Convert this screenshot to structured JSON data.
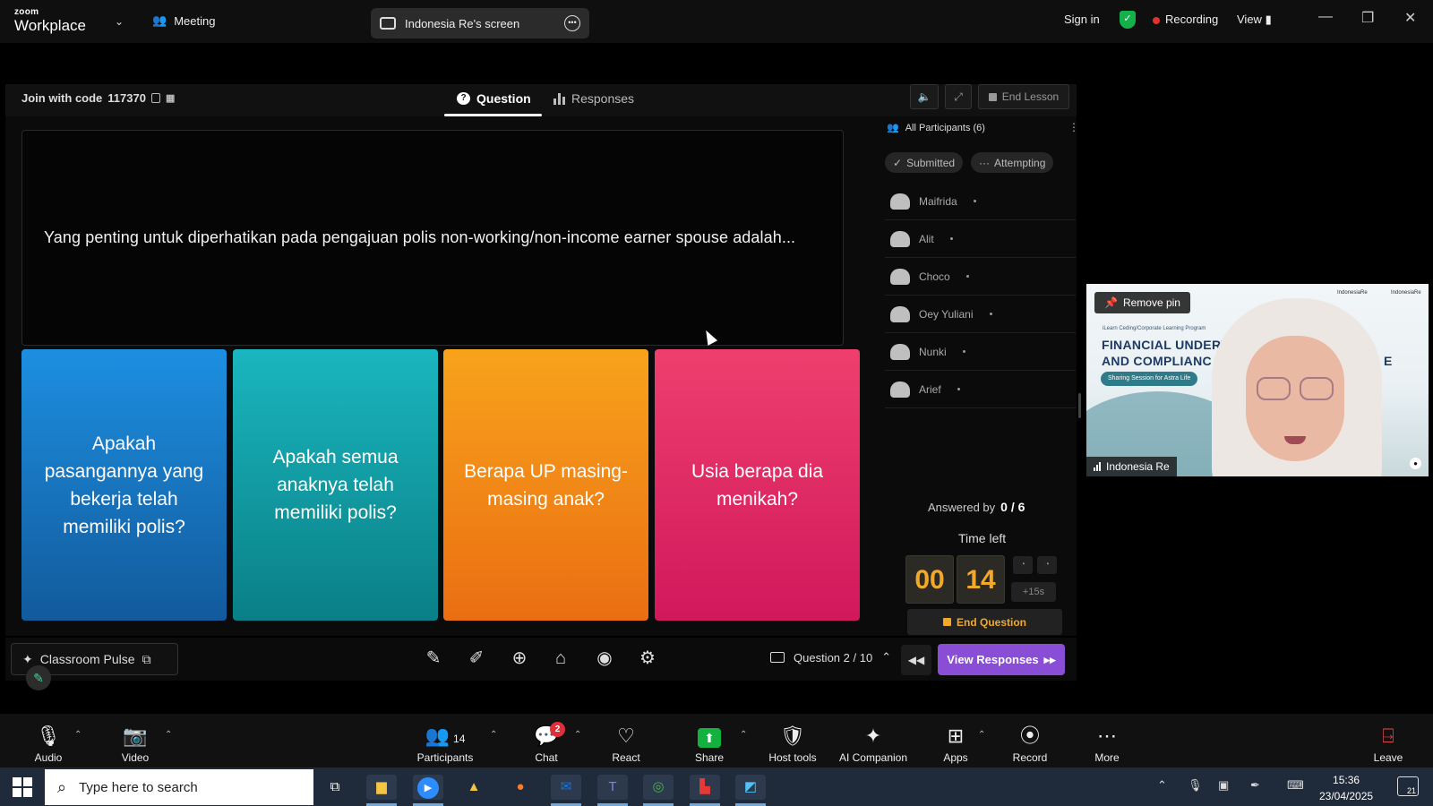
{
  "topbar": {
    "logo_small": "zoom",
    "logo_large": "Workplace",
    "meeting_label": "Meeting",
    "screen_share_label": "Indonesia Re's screen",
    "sign_in": "Sign in",
    "recording": "Recording",
    "view": "View"
  },
  "lesson": {
    "join_label": "Join with code",
    "join_code": "117370",
    "tabs": [
      "Question",
      "Responses"
    ],
    "end_lesson": "End Lesson",
    "question": "Yang penting untuk diperhatikan pada pengajuan polis non-working/non-income earner spouse adalah...",
    "answers": [
      {
        "text": "Apakah pasangannya yang bekerja telah memiliki polis?",
        "color": "#1d8fe0"
      },
      {
        "text": "Apakah semua anaknya telah memiliki polis?",
        "color": "#1ab6bf"
      },
      {
        "text": "Berapa UP masing-masing anak?",
        "color": "#f8a31c"
      },
      {
        "text": "Usia berapa dia menikah?",
        "color": "#ee3f6e"
      }
    ]
  },
  "participants": {
    "header": "All Participants (6)",
    "filters": [
      "Submitted",
      "Attempting"
    ],
    "list": [
      "Maifrida",
      "Alit",
      "Choco",
      "Oey Yuliani",
      "Nunki",
      "Arief"
    ],
    "answered_label": "Answered by",
    "answered_value": "0 / 6"
  },
  "timer": {
    "label": "Time left",
    "minutes": "00",
    "seconds": "14",
    "add_time": "+15s",
    "end_question": "End Question",
    "accent": "#f2a92a"
  },
  "lesson_toolbar": {
    "classroom_pulse": "Classroom Pulse",
    "question_nav": "Question 2 / 10",
    "view_responses": "View Responses",
    "accent": "#8a4dd6"
  },
  "video": {
    "remove_pin": "Remove pin",
    "participant_name": "Indonesia Re",
    "slide_subtitle": "iLearn Ceding/Corporate Learning Program",
    "slide_title_1": "FINANCIAL UNDERW",
    "slide_title_2": "AND COMPLIANC",
    "slide_title_3": "E",
    "slide_pill": "Sharing Session for Astra Life",
    "logo_left": "IndonesiaRe",
    "logo_right": "IndonesiaRe"
  },
  "zoom_toolbar": {
    "audio": "Audio",
    "video": "Video",
    "participants": "Participants",
    "participants_count": "14",
    "chat": "Chat",
    "chat_badge": "2",
    "react": "React",
    "share": "Share",
    "host_tools": "Host tools",
    "ai_companion": "AI Companion",
    "apps": "Apps",
    "record": "Record",
    "more": "More",
    "leave": "Leave"
  },
  "taskbar": {
    "search_placeholder": "Type here to search",
    "time": "15:36",
    "date": "23/04/2025",
    "notification_count": "21"
  }
}
